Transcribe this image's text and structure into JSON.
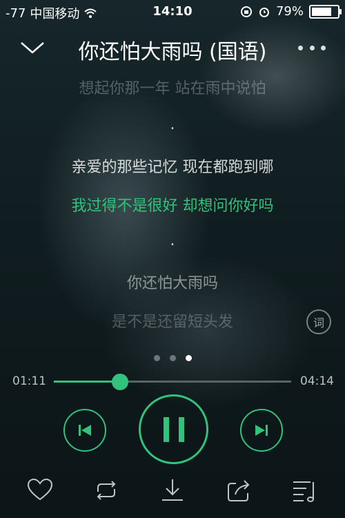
{
  "status_bar": {
    "signal": "-77",
    "carrier": "中国移动",
    "time": "14:10",
    "battery_percent": "79%",
    "battery_level": 0.79
  },
  "header": {
    "title": "你还怕大雨吗 (国语)"
  },
  "lyrics": [
    {
      "text": "想起你那一年 站在雨中说怕",
      "state": "fade"
    },
    {
      "text": ".",
      "state": "normal"
    },
    {
      "text": "亲爱的那些记忆 现在都跑到哪",
      "state": "normal"
    },
    {
      "text": "我过得不是很好 却想问你好吗",
      "state": "current"
    },
    {
      "text": ".",
      "state": "normal"
    },
    {
      "text": "你还怕大雨吗",
      "state": "dim"
    },
    {
      "text": "是不是还留短头发",
      "state": "fade"
    }
  ],
  "lyrics_button_label": "词",
  "page_dots": {
    "count": 3,
    "active_index": 2
  },
  "player": {
    "current_time": "01:11",
    "total_time": "04:14",
    "progress": 0.28
  },
  "colors": {
    "accent": "#31c27c",
    "text": "#ffffff"
  },
  "icons": {
    "back": "chevron-down-icon",
    "more": "more-dots-icon",
    "prev": "previous-track-icon",
    "pause": "pause-icon",
    "next": "next-track-icon",
    "like": "heart-icon",
    "repeat": "repeat-icon",
    "download": "download-icon",
    "share": "share-icon",
    "playlist": "playlist-icon"
  }
}
